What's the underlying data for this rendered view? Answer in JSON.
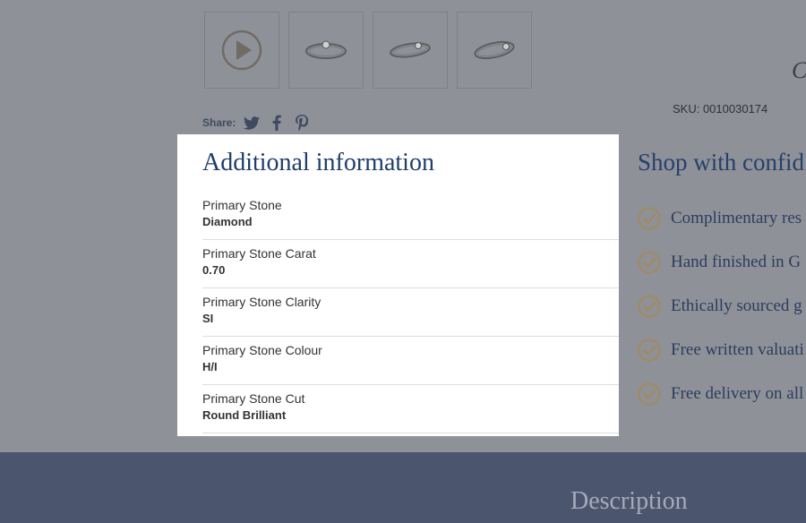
{
  "gallery": {
    "thumbnails": [
      {
        "icon": "play-icon"
      },
      {
        "icon": "ring-icon"
      },
      {
        "icon": "ring-icon"
      },
      {
        "icon": "ring-icon"
      }
    ]
  },
  "brand_glyph": "C",
  "sku": "SKU: 0010030174",
  "share": {
    "label": "Share:",
    "icons": [
      "twitter-icon",
      "facebook-icon",
      "pinterest-icon"
    ]
  },
  "additional_info": {
    "title": "Additional information",
    "rows": [
      {
        "label": "Primary Stone",
        "value": "Diamond"
      },
      {
        "label": "Primary Stone Carat",
        "value": "0.70"
      },
      {
        "label": "Primary Stone Clarity",
        "value": "SI"
      },
      {
        "label": "Primary Stone Colour",
        "value": "H/I"
      },
      {
        "label": "Primary Stone Cut",
        "value": "Round Brilliant"
      }
    ]
  },
  "confidence": {
    "title": "Shop with confid",
    "items": [
      "Complimentary res",
      "Hand finished in G",
      "Ethically sourced g",
      "Free written valuati",
      "Free delivery on all"
    ]
  },
  "footer": {
    "tab_label": "Description"
  },
  "colors": {
    "overlay": "#8f9198",
    "modal_bg": "#ffffff",
    "heading": "#1f3e6b",
    "footer_bg": "#4c556e",
    "check": "#a08a62"
  }
}
